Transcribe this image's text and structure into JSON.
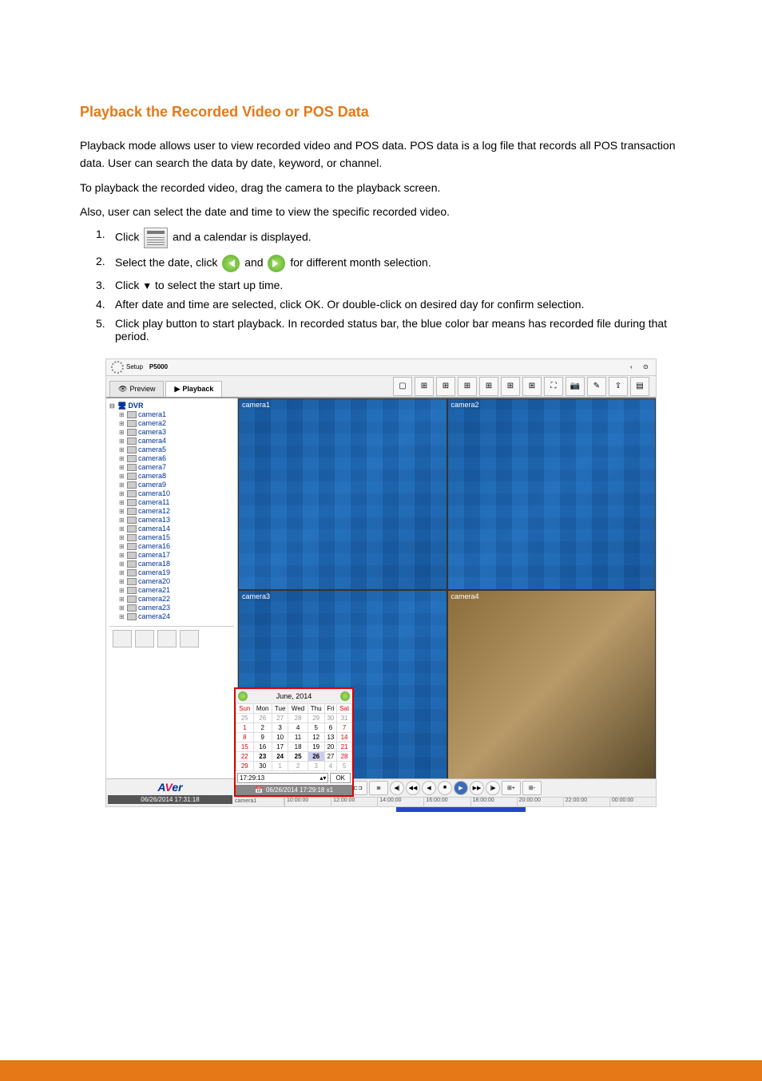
{
  "heading": "Playback the Recorded Video or POS Data",
  "paragraphs": {
    "p1a": "Playback mode allows user to view recorded video and POS data. POS data is a log file that records all POS transaction data. User can search the data by date, keyword, or channel.",
    "p1b": "To playback the recorded video, drag the camera to the playback screen.",
    "p1c": "Also, user can select the date and time to view the specific recorded video."
  },
  "steps": {
    "s1_label": "1.",
    "s1_pre": "Click ",
    "s1_post": " and a calendar is displayed.",
    "s2_label": "2.",
    "s2_pre": "Select the date, click ",
    "s2_mid": " and ",
    "s2_post": " for different month selection.",
    "s3_label": "3.",
    "s3_pre": "Click ",
    "s3_arrow": "▼",
    "s3_post": " to select the start up time.",
    "s4_label": "4.",
    "s4_text": "After date and time are selected, click OK. Or double-click on desired day for confirm selection.",
    "s5_label": "5.",
    "s5_text": "Click play button to start playback. In recorded status bar, the blue color bar means has recorded file during that period."
  },
  "screenshot": {
    "topbar": {
      "setup": "Setup",
      "title": "P5000"
    },
    "tabs": {
      "preview": "Preview",
      "playback": "Playback"
    },
    "tree": {
      "root": "DVR",
      "cameras": [
        "camera1",
        "camera2",
        "camera3",
        "camera4",
        "camera5",
        "camera6",
        "camera7",
        "camera8",
        "camera9",
        "camera10",
        "camera11",
        "camera12",
        "camera13",
        "camera14",
        "camera15",
        "camera16",
        "camera17",
        "camera18",
        "camera19",
        "camera20",
        "camera21",
        "camera22",
        "camera23",
        "camera24"
      ]
    },
    "video_labels": [
      "camera1",
      "camera2",
      "camera3",
      "camera4"
    ],
    "calendar": {
      "month": "June",
      "year": "2014",
      "dow": [
        "Sun",
        "Mon",
        "Tue",
        "Wed",
        "Thu",
        "Fri",
        "Sat"
      ],
      "weeks": [
        [
          {
            "d": "25",
            "cls": "gray"
          },
          {
            "d": "26",
            "cls": "gray"
          },
          {
            "d": "27",
            "cls": "gray"
          },
          {
            "d": "28",
            "cls": "gray"
          },
          {
            "d": "29",
            "cls": "gray"
          },
          {
            "d": "30",
            "cls": "gray"
          },
          {
            "d": "31",
            "cls": "gray"
          }
        ],
        [
          {
            "d": "1",
            "cls": "wknd"
          },
          {
            "d": "2"
          },
          {
            "d": "3"
          },
          {
            "d": "4"
          },
          {
            "d": "5"
          },
          {
            "d": "6"
          },
          {
            "d": "7",
            "cls": "wknd"
          }
        ],
        [
          {
            "d": "8",
            "cls": "wknd"
          },
          {
            "d": "9"
          },
          {
            "d": "10"
          },
          {
            "d": "11"
          },
          {
            "d": "12"
          },
          {
            "d": "13"
          },
          {
            "d": "14",
            "cls": "wknd"
          }
        ],
        [
          {
            "d": "15",
            "cls": "wknd"
          },
          {
            "d": "16"
          },
          {
            "d": "17"
          },
          {
            "d": "18"
          },
          {
            "d": "19"
          },
          {
            "d": "20"
          },
          {
            "d": "21",
            "cls": "wknd"
          }
        ],
        [
          {
            "d": "22",
            "cls": "wknd"
          },
          {
            "d": "23",
            "cls": "bold"
          },
          {
            "d": "24",
            "cls": "bold"
          },
          {
            "d": "25",
            "cls": "bold"
          },
          {
            "d": "26",
            "cls": "selected bold"
          },
          {
            "d": "27"
          },
          {
            "d": "28",
            "cls": "wknd"
          }
        ],
        [
          {
            "d": "29",
            "cls": "wknd"
          },
          {
            "d": "30"
          },
          {
            "d": "1",
            "cls": "gray"
          },
          {
            "d": "2",
            "cls": "gray"
          },
          {
            "d": "3",
            "cls": "gray"
          },
          {
            "d": "4",
            "cls": "gray"
          },
          {
            "d": "5",
            "cls": "gray"
          }
        ]
      ],
      "time": "17:29:13",
      "ok": "OK",
      "datebar": "06/26/2014 17:29:18 x1"
    },
    "logo_datetime": "06/26/2014 17:31:18",
    "timeline": {
      "camera_label": "camera1",
      "ticks": [
        "10:00:00",
        "12:00:00",
        "14:00:00",
        "16:00:00",
        "18:00:00",
        "20:00:00",
        "22:00:00",
        "00:00:00"
      ]
    }
  }
}
